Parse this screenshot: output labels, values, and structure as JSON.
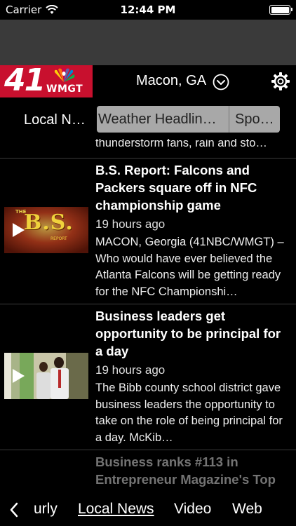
{
  "status_bar": {
    "carrier": "Carrier",
    "time": "12:44 PM",
    "battery_level": 1.0
  },
  "header": {
    "logo": {
      "channel_number": "41",
      "call_sign": "WMGT"
    },
    "location": "Macon, GA"
  },
  "tabs": [
    {
      "label": "Local N…",
      "state": "active"
    },
    {
      "label": "Weather Headlin…",
      "state": "inactive"
    },
    {
      "label": "Spo…",
      "state": "inactive"
    }
  ],
  "news": {
    "top_snippet": "thunderstorm fans, rain and sto…",
    "items": [
      {
        "title": "B.S. Report: Falcons and Packers square off in NFC championship game",
        "time": "19 hours ago",
        "body": "MACON, Georgia (41NBC/WMGT) – Who would have ever believed the Atlanta Falcons will be getting ready for the NFC Championshi…",
        "thumb_text": "B.S.",
        "thumb_small_top": "THE",
        "thumb_small_bottom": "REPORT"
      },
      {
        "title": "Business leaders get opportunity to be principal for a day",
        "time": "19 hours ago",
        "body": "The Bibb county school district gave business leaders the opportunity to take on the role of being principal for a day.  McKib…"
      },
      {
        "title": "Business ranks #113 in Entrepreneur Magazine's Top"
      }
    ]
  },
  "bottom_nav": {
    "items": [
      {
        "label": "urly",
        "state": "inactive"
      },
      {
        "label": "Local News",
        "state": "active"
      },
      {
        "label": "Video",
        "state": "inactive"
      },
      {
        "label": "Web",
        "state": "inactive"
      }
    ]
  },
  "colors": {
    "brand_red": "#c8102e",
    "tab_gray": "#a8a8a8",
    "band_gray": "#3a3a3a"
  }
}
